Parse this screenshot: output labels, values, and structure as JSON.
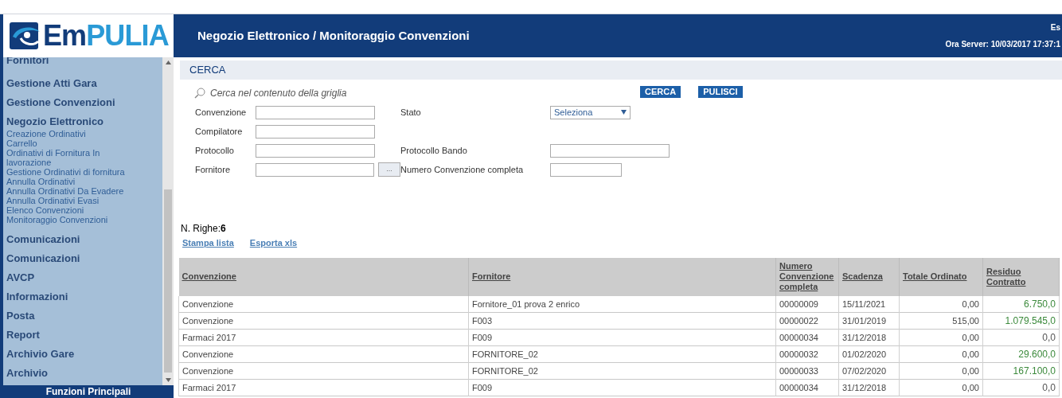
{
  "logo": {
    "dark_part": "Em",
    "light_part": "PULIA"
  },
  "header": {
    "title": "Negozio Elettronico / Monitoraggio Convenzioni",
    "user": "Es",
    "server_time": "Ora Server: 10/03/2017 17:37:1"
  },
  "sidebar": {
    "items": [
      {
        "label": "Fornitori"
      },
      {
        "label": "Gestione Atti Gara"
      },
      {
        "label": "Gestione Convenzioni"
      },
      {
        "label": "Negozio Elettronico",
        "children": [
          {
            "label": "Creazione Ordinativi"
          },
          {
            "label": "Carrello"
          },
          {
            "label": "Ordinativi di Fornitura In lavorazione"
          },
          {
            "label": "Gestione Ordinativi di fornitura"
          },
          {
            "label": "Annulla Ordinativi"
          },
          {
            "label": "Annulla Ordinativi Da Evadere"
          },
          {
            "label": "Annulla Ordinativi Evasi"
          },
          {
            "label": "Elenco Convenzioni"
          },
          {
            "label": "Monitoraggio Convenzioni"
          }
        ]
      },
      {
        "label": "Comunicazioni"
      },
      {
        "label": "Comunicazioni"
      },
      {
        "label": "AVCP"
      },
      {
        "label": "Informazioni"
      },
      {
        "label": "Posta"
      },
      {
        "label": "Report"
      },
      {
        "label": "Archivio Gare"
      },
      {
        "label": "Archivio"
      }
    ],
    "footer": "Funzioni Principali"
  },
  "search_panel": {
    "title": "CERCA",
    "grid_search": "Cerca nel contenuto della griglia",
    "buttons": [
      "CERCA",
      "PULISCI"
    ],
    "rows": [
      [
        {
          "label": "Convenzione",
          "kind": "text"
        },
        {
          "label": "Stato",
          "kind": "select",
          "value": "Seleziona"
        }
      ],
      [
        {
          "label": "Compilatore",
          "kind": "text"
        }
      ],
      [
        {
          "label": "Protocollo",
          "kind": "text"
        },
        {
          "label": "Protocollo Bando",
          "kind": "text"
        }
      ],
      [
        {
          "label": "Fornitore",
          "kind": "lookup",
          "button": "..."
        },
        {
          "label": "Numero Convenzione completa",
          "kind": "text"
        }
      ]
    ]
  },
  "results": {
    "count_label": "N. Righe:",
    "count": "6",
    "links": [
      "Stampa lista",
      "Esporta xls"
    ]
  },
  "table": {
    "columns": [
      "Convenzione",
      "Fornitore",
      "Numero Convenzione completa",
      "Scadenza",
      "Totale Ordinato",
      "Residuo Contratto"
    ],
    "rows": [
      {
        "cells": [
          "Convenzione",
          "Fornitore_01 prova 2 enrico",
          "00000009",
          "15/11/2021",
          "0,00",
          "6.750,0"
        ],
        "color": "#3c8a3c"
      },
      {
        "cells": [
          "Convenzione",
          "F003",
          "00000022",
          "31/01/2019",
          "515,00",
          "1.079.545,0"
        ],
        "color": "#3c8a3c"
      },
      {
        "cells": [
          "Farmaci 2017",
          "F009",
          "00000034",
          "31/12/2018",
          "0,00",
          "0,0"
        ],
        "color": "#555555"
      },
      {
        "cells": [
          "Convenzione",
          "FORNITORE_02",
          "00000032",
          "01/02/2020",
          "0,00",
          "29.600,0"
        ],
        "color": "#3c8a3c"
      },
      {
        "cells": [
          "Convenzione",
          "FORNITORE_02",
          "00000033",
          "07/02/2020",
          "0,00",
          "167.100,0"
        ],
        "color": "#3c8a3c"
      },
      {
        "cells": [
          "Farmaci 2017",
          "F009",
          "00000034",
          "31/12/2018",
          "0,00",
          "0,0"
        ],
        "color": "#555555"
      }
    ]
  }
}
